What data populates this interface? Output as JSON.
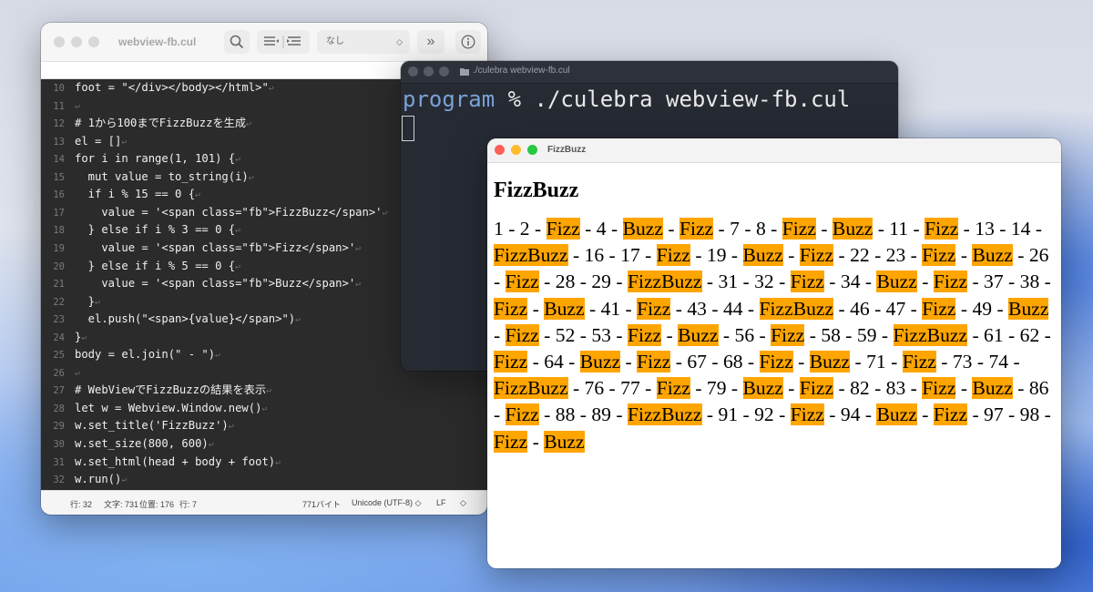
{
  "editor": {
    "title": "webview-fb.cul",
    "toolbar": {
      "syntax_select": "なし"
    },
    "lines": [
      {
        "n": "10",
        "text": "foot = \"</div></body></html>\""
      },
      {
        "n": "11",
        "text": ""
      },
      {
        "n": "12",
        "text": "# 1から100までFizzBuzzを生成"
      },
      {
        "n": "13",
        "text": "el = []"
      },
      {
        "n": "14",
        "text": "for i in range(1, 101) {"
      },
      {
        "n": "15",
        "text": "  mut value = to_string(i)"
      },
      {
        "n": "16",
        "text": "  if i % 15 == 0 {"
      },
      {
        "n": "17",
        "text": "    value = '<span class=\"fb\">FizzBuzz</span>'"
      },
      {
        "n": "18",
        "text": "  } else if i % 3 == 0 {"
      },
      {
        "n": "19",
        "text": "    value = '<span class=\"fb\">Fizz</span>'"
      },
      {
        "n": "20",
        "text": "  } else if i % 5 == 0 {"
      },
      {
        "n": "21",
        "text": "    value = '<span class=\"fb\">Buzz</span>'"
      },
      {
        "n": "22",
        "text": "  }"
      },
      {
        "n": "23",
        "text": "  el.push(\"<span>{value}</span>\")"
      },
      {
        "n": "24",
        "text": "}"
      },
      {
        "n": "25",
        "text": "body = el.join(\" - \")"
      },
      {
        "n": "26",
        "text": ""
      },
      {
        "n": "27",
        "text": "# WebViewでFizzBuzzの結果を表示"
      },
      {
        "n": "28",
        "text": "let w = Webview.Window.new()"
      },
      {
        "n": "29",
        "text": "w.set_title('FizzBuzz')"
      },
      {
        "n": "30",
        "text": "w.set_size(800, 600)"
      },
      {
        "n": "31",
        "text": "w.set_html(head + body + foot)"
      },
      {
        "n": "32",
        "text": "w.run()"
      }
    ],
    "return_mark": "↩",
    "status": {
      "line": "行: 32",
      "chars": "文字: 731",
      "position": "位置: 176",
      "line2": "行: 7",
      "bytes": "771バイト",
      "encoding": "Unicode (UTF-8) ◇",
      "line_ending": "LF",
      "line_ending_arrow": "◇"
    }
  },
  "terminal": {
    "title": "./culebra webview-fb.cul",
    "prompt_dir": "program",
    "command": " % ./culebra webview-fb.cul"
  },
  "webview": {
    "title": "FizzBuzz",
    "heading": "FizzBuzz",
    "separator": " - ",
    "items": [
      "1",
      "2",
      "Fizz",
      "4",
      "Buzz",
      "Fizz",
      "7",
      "8",
      "Fizz",
      "Buzz",
      "11",
      "Fizz",
      "13",
      "14",
      "FizzBuzz",
      "16",
      "17",
      "Fizz",
      "19",
      "Buzz",
      "Fizz",
      "22",
      "23",
      "Fizz",
      "Buzz",
      "26",
      "Fizz",
      "28",
      "29",
      "FizzBuzz",
      "31",
      "32",
      "Fizz",
      "34",
      "Buzz",
      "Fizz",
      "37",
      "38",
      "Fizz",
      "Buzz",
      "41",
      "Fizz",
      "43",
      "44",
      "FizzBuzz",
      "46",
      "47",
      "Fizz",
      "49",
      "Buzz",
      "Fizz",
      "52",
      "53",
      "Fizz",
      "Buzz",
      "56",
      "Fizz",
      "58",
      "59",
      "FizzBuzz",
      "61",
      "62",
      "Fizz",
      "64",
      "Buzz",
      "Fizz",
      "67",
      "68",
      "Fizz",
      "Buzz",
      "71",
      "Fizz",
      "73",
      "74",
      "FizzBuzz",
      "76",
      "77",
      "Fizz",
      "79",
      "Buzz",
      "Fizz",
      "82",
      "83",
      "Fizz",
      "Buzz",
      "86",
      "Fizz",
      "88",
      "89",
      "FizzBuzz",
      "91",
      "92",
      "Fizz",
      "94",
      "Buzz",
      "Fizz",
      "97",
      "98",
      "Fizz",
      "Buzz"
    ],
    "highlight_color": "#ffa500"
  },
  "colors": {
    "traffic_close": "#ff5f57",
    "traffic_minimize": "#febc2e",
    "traffic_zoom": "#28c840"
  }
}
